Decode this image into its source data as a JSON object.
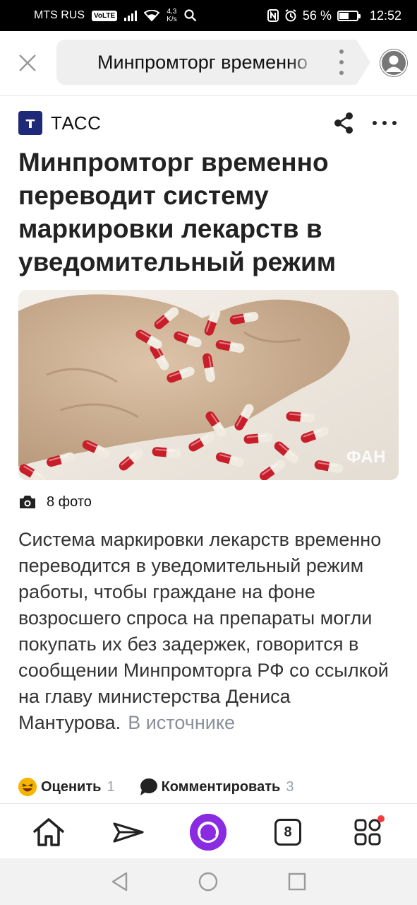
{
  "status_bar": {
    "carrier": "MTS RUS",
    "volte": "VoLTE",
    "speed_value": "4,3",
    "speed_unit": "K/s",
    "battery_percent": "56 %",
    "battery_level": 0.56,
    "time": "12:52"
  },
  "browser": {
    "url_title": "Минпромторг временно переводит систему маркировки лекарств в уведомительный режим"
  },
  "article": {
    "source_logo_letter": "т",
    "source_name": "ТАСС",
    "headline": "Минпромторг временно переводит систему маркировки лекарств в уведомительный режим",
    "photo_watermark": "ФАН",
    "photos_count": "8 фото",
    "body": "Система маркировки лекарств временно переводится в уведомительный режим работы, чтобы граждане на фоне возросшего спроса на препараты могли покупать их без задержек, говорится в сообщении Минпромторга РФ со ссылкой на главу министерства Дениса Мантурова.",
    "source_link": "В источнике"
  },
  "actions": {
    "rate_label": "Оценить",
    "rate_count": "1",
    "comment_label": "Комментировать",
    "comment_count": "3"
  },
  "toolbar": {
    "tabs_count": "8"
  },
  "colors": {
    "tass_blue": "#1e2a78",
    "alice_purple": "#8a2be2",
    "link_gray": "#8a8f99",
    "pill_red": "#c81e2a",
    "notification_red": "#f23c3c"
  }
}
